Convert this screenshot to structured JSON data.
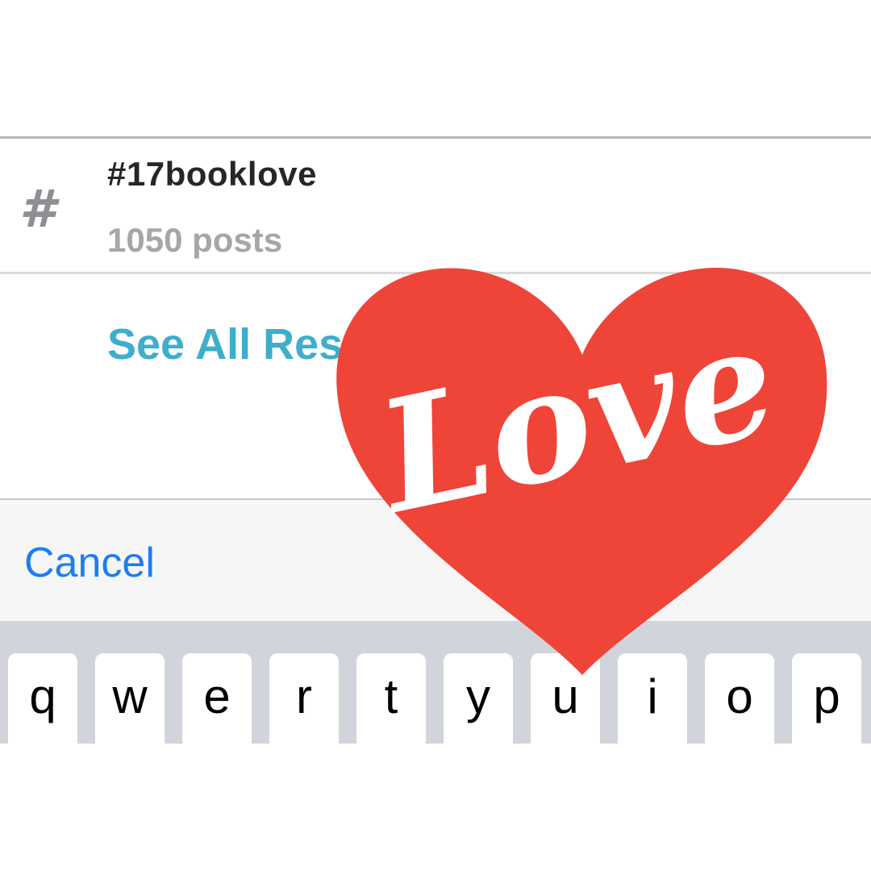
{
  "search_results": {
    "hashtag_icon": "hash-icon",
    "hashtag_name": "#17booklove",
    "hashtag_post_count": "1050 posts",
    "see_all_label": "See All Results"
  },
  "toolbar": {
    "cancel_label": "Cancel"
  },
  "keyboard": {
    "row1_keys": [
      "q",
      "w",
      "e",
      "r",
      "t",
      "y",
      "u",
      "i",
      "o",
      "p"
    ]
  },
  "sticker": {
    "text": "Love",
    "icon": "heart-icon",
    "color": "#ef4438"
  },
  "colors": {
    "link_blue": "#1a7ef5",
    "see_all_teal": "#3eaecb",
    "heart_red": "#ef4438"
  }
}
